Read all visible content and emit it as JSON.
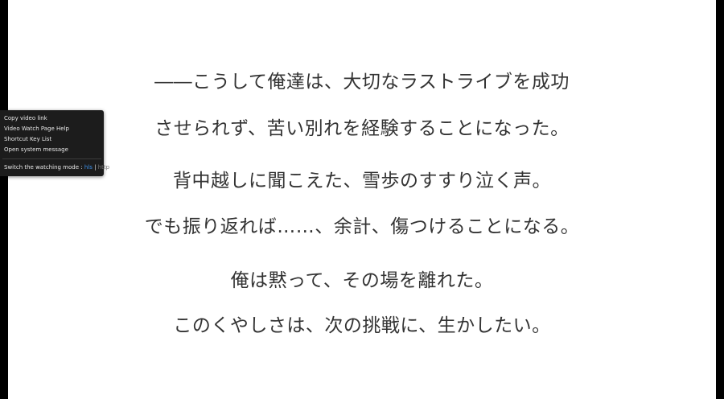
{
  "subtitles": {
    "group1": [
      "――こうして俺達は、大切なラストライブを成功",
      "させられず、苦い別れを経験することになった。"
    ],
    "group2": [
      "背中越しに聞こえた、雪歩のすすり泣く声。",
      "でも振り返れば……、余計、傷つけることになる。"
    ],
    "group3": [
      "俺は黙って、その場を離れた。",
      "このくやしさは、次の挑戦に、生かしたい。"
    ]
  },
  "context_menu": {
    "items": [
      "Copy video link",
      "Video Watch Page Help",
      "Shortcut Key List",
      "Open system message"
    ],
    "mode_label": "Switch the watching mode : ",
    "mode_hls": "hls",
    "mode_separator": " | ",
    "mode_http": "http"
  },
  "colors": {
    "active_mode": "#3b8fe8",
    "inactive_mode": "#777777",
    "subtitle_text": "#333333",
    "menu_bg": "#1c1c1c"
  }
}
